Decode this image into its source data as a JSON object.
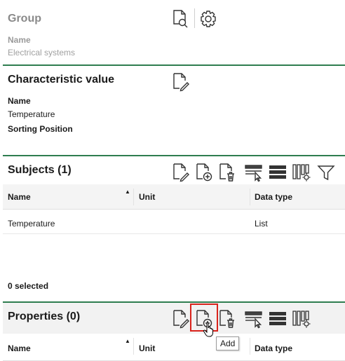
{
  "group": {
    "title": "Group",
    "name_label": "Name",
    "name_value": "Electrical systems"
  },
  "characteristic": {
    "title": "Characteristic value",
    "name_label": "Name",
    "name_value": "Temperature",
    "sorting_label": "Sorting Position",
    "sorting_value": ""
  },
  "subjects": {
    "title": "Subjects (1)",
    "columns": [
      "Name",
      "Unit",
      "Data type"
    ],
    "rows": [
      {
        "name": "Temperature",
        "unit": "",
        "data_type": "List"
      }
    ],
    "selected_text": "0 selected"
  },
  "properties": {
    "title": "Properties (0)",
    "columns": [
      "Name",
      "Unit",
      "Data type"
    ],
    "tooltip": "Add"
  },
  "colors": {
    "section_border": "#2e7d4f",
    "highlight": "#d9231c"
  }
}
